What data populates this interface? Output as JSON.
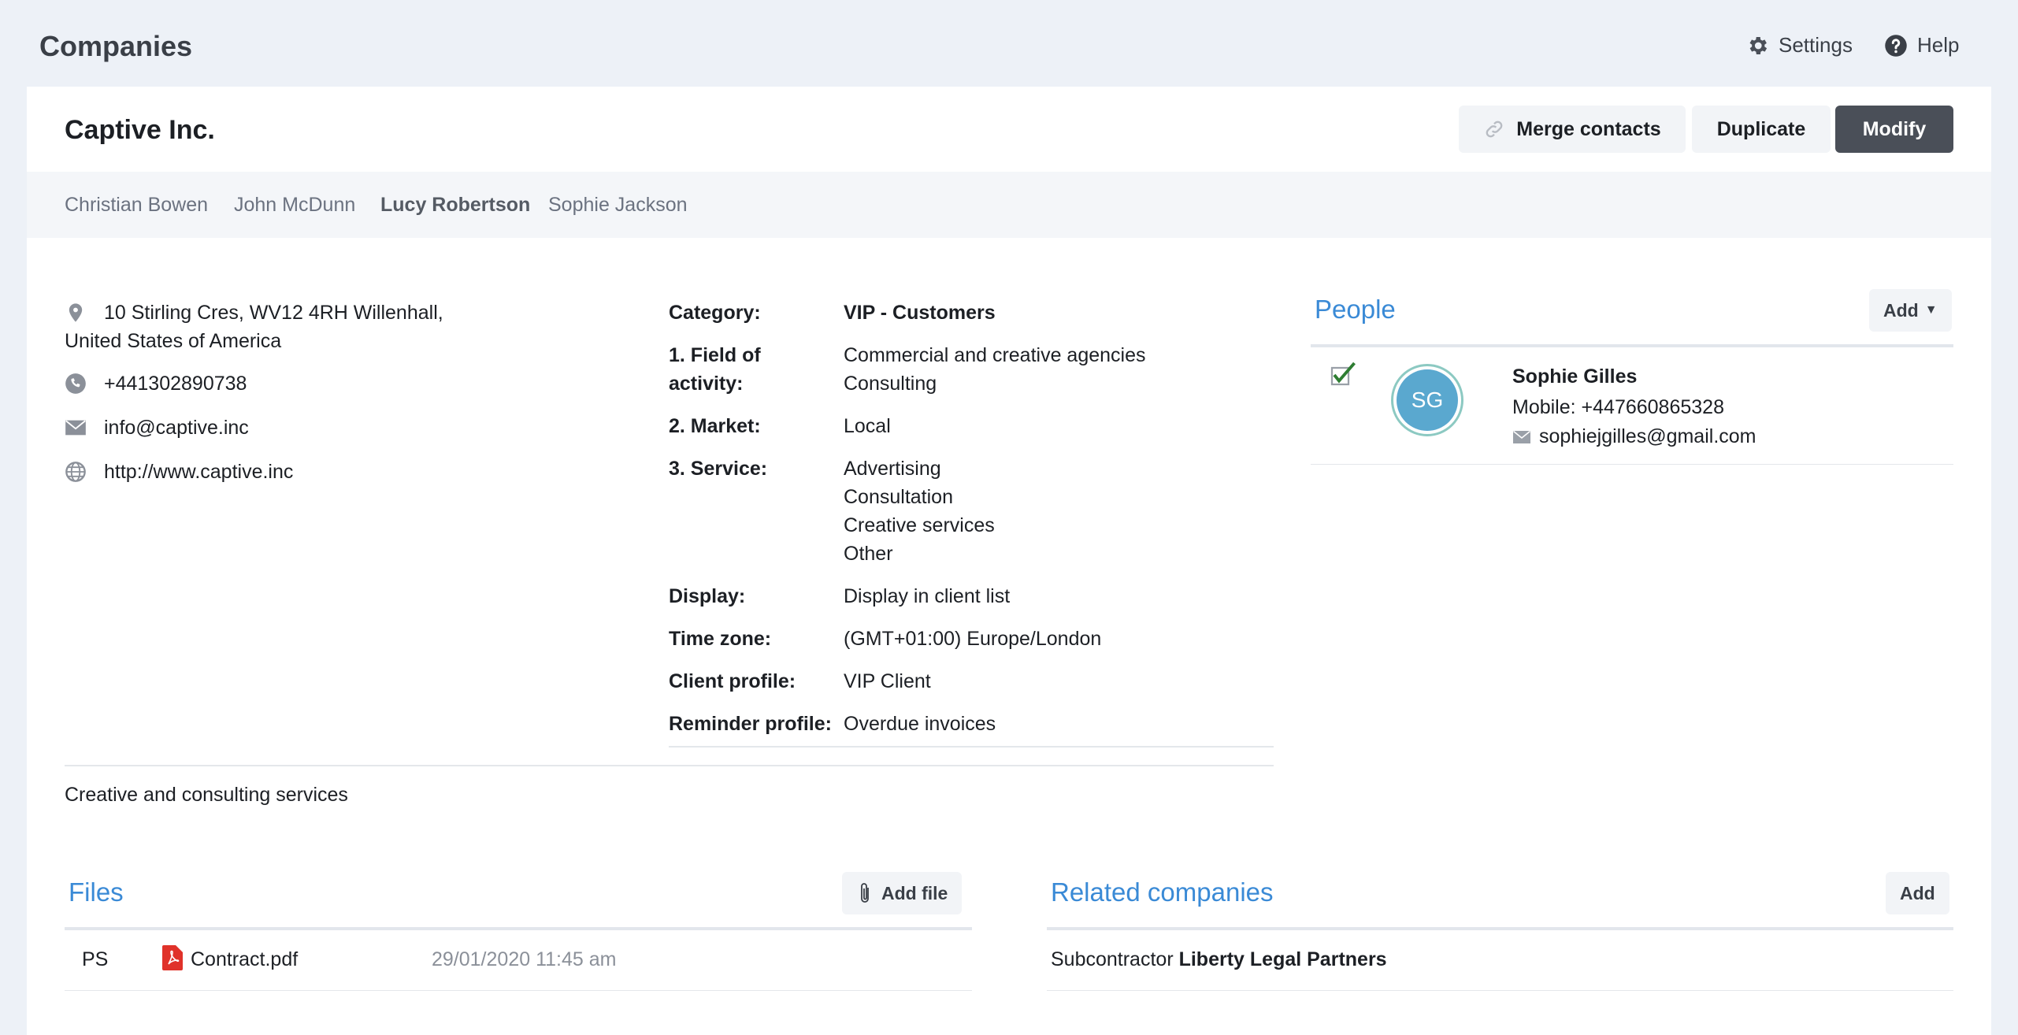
{
  "app": {
    "title": "Companies",
    "settings_label": "Settings",
    "help_label": "Help"
  },
  "company": {
    "name": "Captive Inc.",
    "description": "Creative and consulting services"
  },
  "actions": {
    "merge_label": "Merge contacts",
    "duplicate_label": "Duplicate",
    "modify_label": "Modify"
  },
  "tabs": [
    {
      "label": "Christian Bowen",
      "active": false
    },
    {
      "label": "John McDunn",
      "active": false
    },
    {
      "label": "Lucy Robertson",
      "active": true
    },
    {
      "label": "Sophie Jackson",
      "active": false
    }
  ],
  "contact": {
    "address_line1": "10 Stirling Cres, WV12 4RH Willenhall,",
    "address_line2": "United States of America",
    "phone": "+441302890738",
    "email": "info@captive.inc",
    "website": "http://www.captive.inc"
  },
  "details": {
    "category": {
      "label": "Category:",
      "value": "VIP - Customers"
    },
    "field_of_activity": {
      "label_line1": "1. Field of",
      "label_line2": "activity:",
      "values": [
        "Commercial and creative agencies",
        "Consulting"
      ]
    },
    "market": {
      "label": "2. Market:",
      "value": "Local"
    },
    "service": {
      "label": "3. Service:",
      "values": [
        "Advertising",
        "Consultation",
        "Creative services",
        "Other"
      ]
    },
    "display": {
      "label": "Display:",
      "value": "Display in client list"
    },
    "time_zone": {
      "label": "Time zone:",
      "value": "(GMT+01:00) Europe/London"
    },
    "client_profile": {
      "label": "Client profile:",
      "value": "VIP Client"
    },
    "reminder_profile": {
      "label": "Reminder profile:",
      "value": "Overdue invoices"
    }
  },
  "people": {
    "title": "People",
    "add_label": "Add",
    "items": [
      {
        "initials": "SG",
        "name": "Sophie Gilles",
        "mobile": "Mobile: +447660865328",
        "email": "sophiejgilles@gmail.com"
      }
    ]
  },
  "files": {
    "title": "Files",
    "add_label": "Add file",
    "items": [
      {
        "owner": "PS",
        "name": "Contract.pdf",
        "date": "29/01/2020 11:45 am"
      }
    ]
  },
  "related": {
    "title": "Related companies",
    "add_label": "Add",
    "items": [
      {
        "relation": "Subcontractor",
        "company": "Liberty Legal Partners"
      }
    ]
  },
  "colors": {
    "accent": "#3a8ad6",
    "primary_button": "#4a4f58",
    "avatar": "#5aa8cf",
    "pdf_icon": "#e0322a"
  }
}
